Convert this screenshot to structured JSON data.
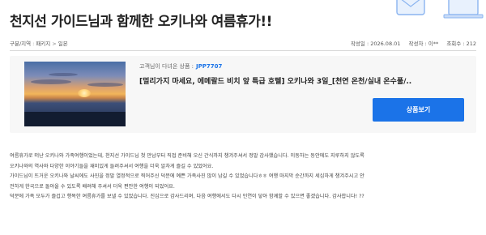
{
  "header": {
    "title": "천지선 가이드님과 함께한 오키나와 여름휴가!!"
  },
  "breadcrumb": {
    "label": "구분/지역",
    "items": [
      "패키지",
      "일본"
    ]
  },
  "meta": {
    "date": "작성일 : 2026.08.01",
    "author": "작성자 : 이**",
    "views": "조회수 : 212"
  },
  "product": {
    "code_label": "고객님이 다녀온 상품 :",
    "code": "JPP7707",
    "name": "[멀리가지 마세요, 에메랄드 비치 앞 특급 호텔] 오키나와 3일_[천연 온천/실내 온수풀/..",
    "button_label": "상품보기",
    "button_color": "#1b73e8"
  },
  "review": {
    "lines": [
      "여름휴가로 떠난 오키나와 가족여행이었는데, 천지선 가이드님 첫 만남부터 직접 준비해 오신 간식까지 챙겨주셔서 정말 감사했습니다. 이동하는 동안에도 지루하지 않도록",
      "오키나와의 역사와 다양한 이야기들을 재미있게 들려주셔서 여행을 더욱 알차게 즐길 수 있었어요.",
      "가이드님이 뜨거운 오키나와 날씨에도 사진을 정말 열정적으로 찍어주신 덕분에 예쁜 가족사진 많이 남길 수 있었습니다ㅎㅎ 여행 마지막 순간까지 세심하게 챙겨주시고 안",
      "전하게 한국으로 돌아올 수 있도록 배려해 주셔서 더욱 편안한 여행이 되었어요.",
      "덕분에 가족 모두가 즐겁고 행복한 여름휴가를 보낼 수 있었습니다. 진심으로 감사드리며, 다음 여행에서도 다시 인연이 닿아 함께할 수 있으면 좋겠습니다. 감사합니다! ??"
    ]
  }
}
